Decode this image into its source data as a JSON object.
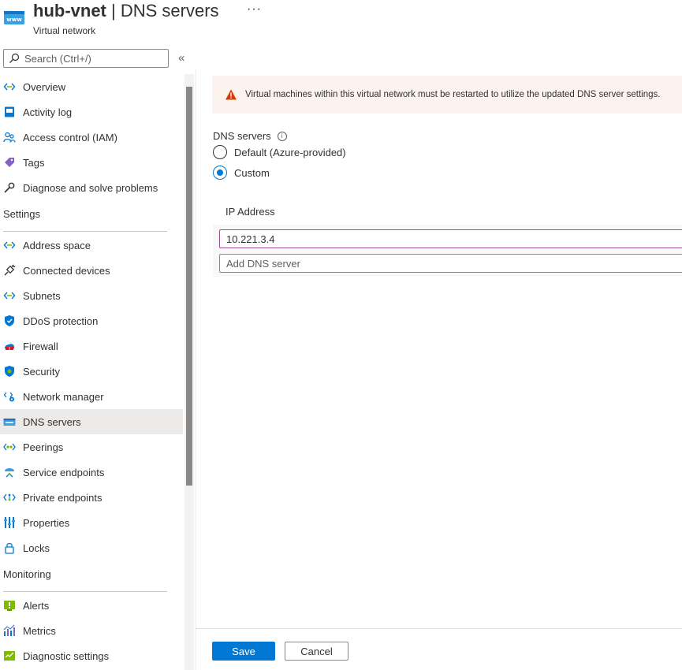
{
  "header": {
    "resource_name": "hub-vnet",
    "separator": " | ",
    "blade_title": "DNS servers",
    "more_label": "···",
    "subtitle": "Virtual network",
    "icon": "www-icon"
  },
  "search": {
    "placeholder": "Search (Ctrl+/)",
    "collapse_label": "«"
  },
  "sidebar": {
    "top_items": [
      {
        "label": "Overview",
        "icon": "network-icon"
      },
      {
        "label": "Activity log",
        "icon": "log-icon"
      },
      {
        "label": "Access control (IAM)",
        "icon": "people-icon"
      },
      {
        "label": "Tags",
        "icon": "tag-icon"
      },
      {
        "label": "Diagnose and solve problems",
        "icon": "wrench-icon"
      }
    ],
    "settings_label": "Settings",
    "settings_items": [
      {
        "label": "Address space",
        "icon": "network-icon"
      },
      {
        "label": "Connected devices",
        "icon": "plug-icon"
      },
      {
        "label": "Subnets",
        "icon": "network-icon"
      },
      {
        "label": "DDoS protection",
        "icon": "shield-icon"
      },
      {
        "label": "Firewall",
        "icon": "firewall-icon"
      },
      {
        "label": "Security",
        "icon": "security-icon"
      },
      {
        "label": "Network manager",
        "icon": "network-manager-icon"
      },
      {
        "label": "DNS servers",
        "icon": "dns-icon",
        "selected": true
      },
      {
        "label": "Peerings",
        "icon": "peering-icon"
      },
      {
        "label": "Service endpoints",
        "icon": "service-endpoint-icon"
      },
      {
        "label": "Private endpoints",
        "icon": "private-endpoint-icon"
      },
      {
        "label": "Properties",
        "icon": "properties-icon"
      },
      {
        "label": "Locks",
        "icon": "lock-icon"
      }
    ],
    "monitoring_label": "Monitoring",
    "monitoring_items": [
      {
        "label": "Alerts",
        "icon": "alert-icon"
      },
      {
        "label": "Metrics",
        "icon": "metrics-icon"
      },
      {
        "label": "Diagnostic settings",
        "icon": "diagnostic-icon"
      }
    ]
  },
  "main": {
    "warning": "Virtual machines within this virtual network must be restarted to utilize the updated DNS server settings.",
    "dns_label": "DNS servers",
    "info_glyph": "i",
    "radio_default": "Default (Azure-provided)",
    "radio_custom": "Custom",
    "selected_option": "Custom",
    "ip_header": "IP Address",
    "ip_value": "10.221.3.4",
    "add_placeholder": "Add DNS server"
  },
  "footer": {
    "save": "Save",
    "cancel": "Cancel"
  },
  "colors": {
    "accent": "#0078d4",
    "warning": "#d83b01",
    "warning_bg": "#fdf3ee",
    "selected_bg": "#edebe9"
  }
}
